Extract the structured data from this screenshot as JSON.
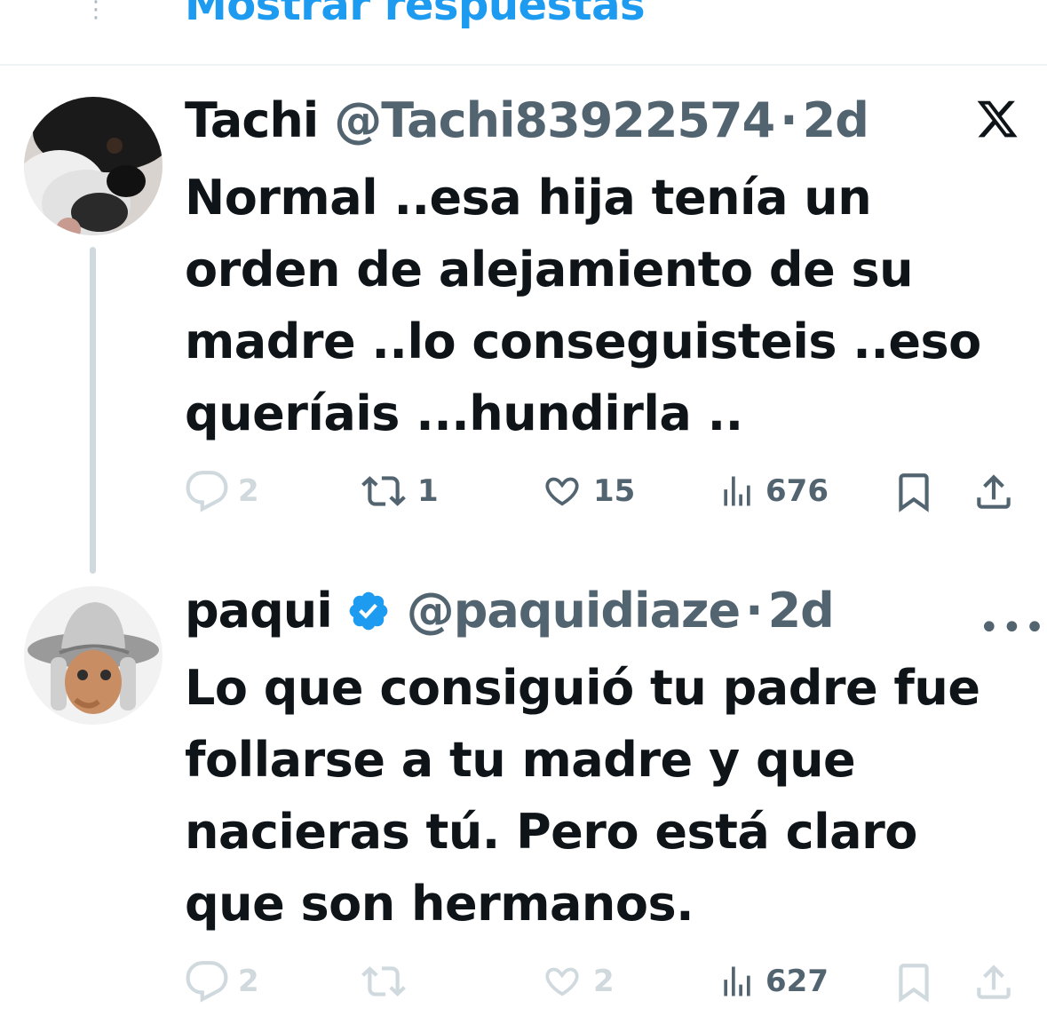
{
  "top": {
    "show_replies": "Mostrar respuestas"
  },
  "tweets": [
    {
      "name": "Tachi",
      "handle": "@Tachi83922574",
      "separator": "·",
      "time": "2d",
      "text": "Normal ..esa hija tenía un\norden de alejamiento de su\nmadre ..lo conseguisteis ..eso\nqueríais ...hundirla ..",
      "replies": "2",
      "retweets": "1",
      "likes": "15",
      "views": "676",
      "menu_icon": "x-logo-icon"
    },
    {
      "name": "paqui",
      "handle": "@paquidiaze",
      "separator": "·",
      "time": "2d",
      "verified": true,
      "text": "Lo que consiguió tu padre fue\nfollarse a tu madre y que\nnacieras tú. Pero está claro\nque son hermanos.",
      "replies": "2",
      "retweets": "",
      "likes": "2",
      "views": "627",
      "menu_icon": "more-icon"
    }
  ],
  "colors": {
    "accent": "#1d9bf0",
    "text": "#0f1419",
    "secondary": "#536471",
    "faded": "#cfd9de"
  }
}
